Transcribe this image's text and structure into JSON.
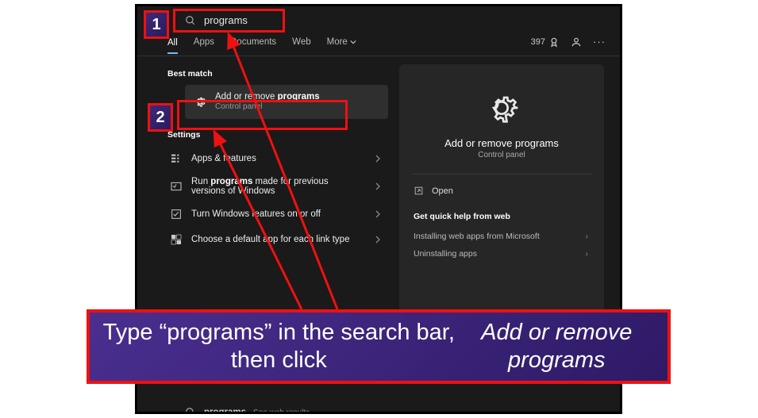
{
  "search": {
    "query": "programs"
  },
  "tabs": {
    "all": "All",
    "apps": "Apps",
    "documents": "Documents",
    "web": "Web",
    "more": "More"
  },
  "top_right": {
    "rewards": "397"
  },
  "left": {
    "best_match_label": "Best match",
    "best_match": {
      "title_pre": "Add or remove ",
      "title_bold": "programs",
      "subtitle": "Control panel"
    },
    "settings_label": "Settings",
    "settings": [
      {
        "icon": "apps-features-icon",
        "title": "Apps & features"
      },
      {
        "icon": "run-icon",
        "title_pre": "Run ",
        "title_bold": "programs",
        "title_post": " made for previous versions of Windows"
      },
      {
        "icon": "features-icon",
        "title": "Turn Windows features on or off"
      },
      {
        "icon": "default-app-icon",
        "title": "Choose a default app for each link type"
      }
    ]
  },
  "right": {
    "title": "Add or remove programs",
    "subtitle": "Control panel",
    "open": "Open",
    "quick_help": "Get quick help from web",
    "links": [
      "Installing web apps from Microsoft",
      "Uninstalling apps"
    ]
  },
  "footer": {
    "query_bold": "programs",
    "suffix": " - See web results"
  },
  "annotations": {
    "num1": "1",
    "num2": "2",
    "banner": "Type “programs” in the search bar, then click <em>Add or remove programs</em>"
  }
}
